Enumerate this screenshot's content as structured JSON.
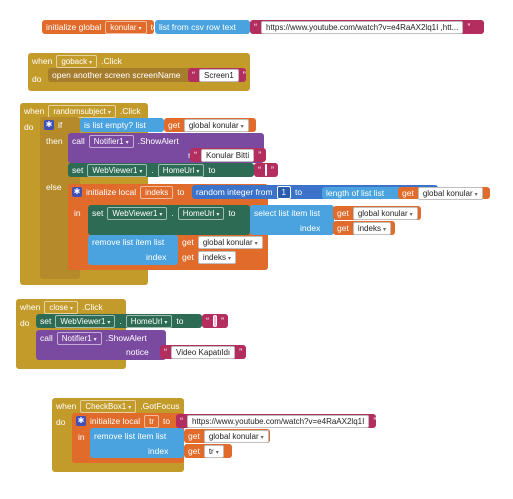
{
  "blocks": {
    "global_init": {
      "kw": "initialize global",
      "name": "konular",
      "to": "to",
      "list_from_csv": "list from csv row  text",
      "url": "https://www.youtube.com/watch?v=e4RaAX2lq1I ,htt..."
    },
    "goback_event": {
      "when": "when",
      "component": "goback",
      "event": ".Click",
      "do": "do",
      "open_screen": "open another screen  screenName",
      "screen_value": "Screen1"
    },
    "random_event": {
      "when": "when",
      "component": "randomsubject",
      "event": ".Click",
      "do": "do",
      "if": "if",
      "is_list_empty": "is list empty?  list",
      "get1": "get",
      "global_konular1": "global konular",
      "then": "then",
      "call": "call",
      "notifier": "Notifier1",
      "show_alert": ".ShowAlert",
      "notice": "notice",
      "notice_text": "Konular Bitti",
      "set1": "set",
      "webviewer": "WebViewer1",
      "dot": ".",
      "homeurl": "HomeUrl",
      "to": "to",
      "else": "else",
      "init_local": "initialize local",
      "indeks_name": "indeks",
      "random_int": "random integer from",
      "from_num": "1",
      "to_kw": "to",
      "length_of_list": "length of list  list",
      "get2": "get",
      "global_konular2": "global konular",
      "in": "in",
      "set2": "set",
      "select_item": "select list item  list",
      "get3": "get",
      "global_konular3": "global konular",
      "index_kw": "index",
      "get4": "get",
      "indeks_get1": "indeks",
      "remove_item": "remove list item  list",
      "get5": "get",
      "global_konular4": "global konular",
      "index_kw2": "index",
      "get6": "get",
      "indeks_get2": "indeks"
    },
    "close_event": {
      "when": "when",
      "component": "close",
      "event": ".Click",
      "do": "do",
      "set": "set",
      "webviewer": "WebViewer1",
      "dot": ".",
      "homeurl": "HomeUrl",
      "to": "to",
      "call": "call",
      "notifier": "Notifier1",
      "show_alert": ".ShowAlert",
      "notice": "notice",
      "notice_text": "Video Kapatıldı"
    },
    "checkbox_event": {
      "when": "when",
      "component": "CheckBox1",
      "event": ".GotFocus",
      "do": "do",
      "init_local": "initialize local",
      "tr_name": "tr",
      "to": "to",
      "url": "https://www.youtube.com/watch?v=e4RaAX2lq1I",
      "in": "in",
      "remove_item": "remove list item  list",
      "get1": "get",
      "global_konular": "global konular",
      "index_kw": "index",
      "get2": "get",
      "tr_get": "tr"
    }
  },
  "colors": {
    "event": "#c39b2b",
    "variable": "#e06b2b",
    "list": "#4aa3df",
    "text": "#b32d5e",
    "component": "#2e6b55",
    "procedure": "#7a4aa0",
    "math": "#3a73c9"
  }
}
